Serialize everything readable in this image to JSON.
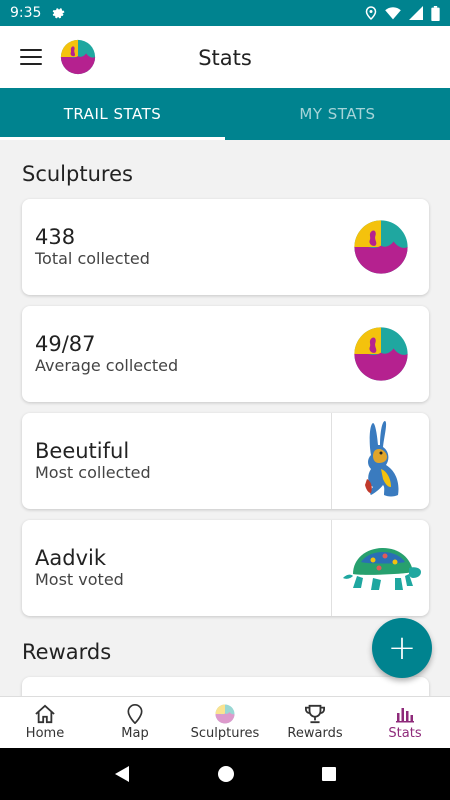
{
  "status_bar": {
    "time": "9:35"
  },
  "app_bar": {
    "title": "Stats"
  },
  "tabs": [
    {
      "label": "TRAIL STATS",
      "active": true
    },
    {
      "label": "MY STATS",
      "active": false
    }
  ],
  "sections": {
    "sculptures_title": "Sculptures",
    "rewards_title": "Rewards"
  },
  "cards": [
    {
      "value": "438",
      "label": "Total collected",
      "image": "trail-logo-icon"
    },
    {
      "value": "49/87",
      "label": "Average collected",
      "image": "trail-logo-icon"
    },
    {
      "value": "Beeutiful",
      "label": "Most collected",
      "image": "hare-sculpture-image"
    },
    {
      "value": "Aadvik",
      "label": "Most voted",
      "image": "tortoise-sculpture-image"
    }
  ],
  "fab": {
    "symbol": "+"
  },
  "bottom_nav": [
    {
      "label": "Home",
      "icon": "home-icon",
      "active": false
    },
    {
      "label": "Map",
      "icon": "map-pin-icon",
      "active": false
    },
    {
      "label": "Sculptures",
      "icon": "sculptures-icon",
      "active": false
    },
    {
      "label": "Rewards",
      "icon": "trophy-icon",
      "active": false
    },
    {
      "label": "Stats",
      "icon": "bar-chart-icon",
      "active": true
    }
  ],
  "colors": {
    "primary": "#00838f",
    "active_nav": "#8e2a7a",
    "logo_yellow": "#f4c20d",
    "logo_magenta": "#b5218f",
    "logo_teal": "#1fa7a0"
  }
}
